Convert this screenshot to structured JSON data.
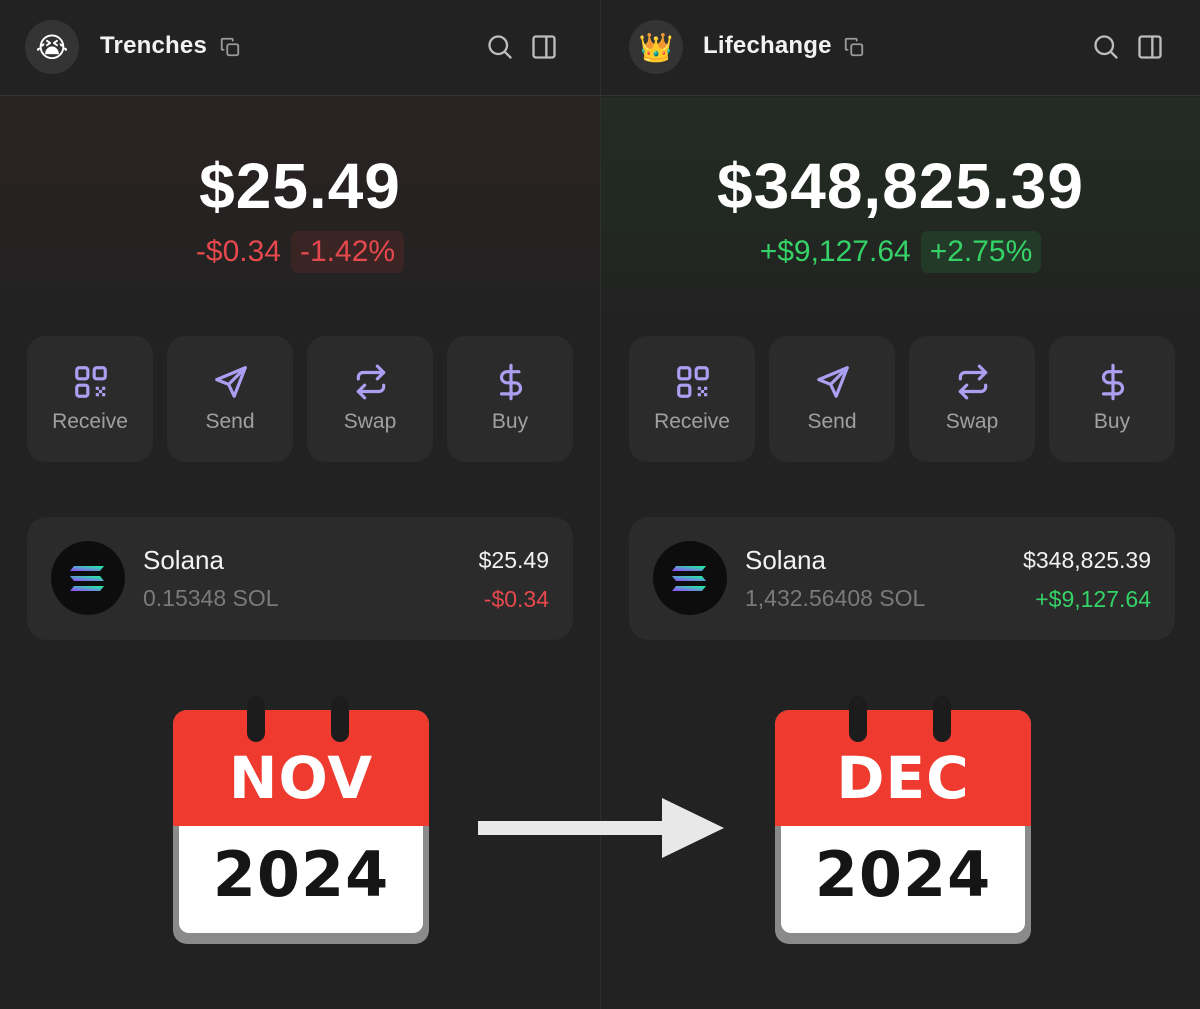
{
  "left": {
    "wallet_name": "Trenches",
    "avatar_emoji": "😭",
    "balance": "$25.49",
    "change_abs": "-$0.34",
    "change_pct": "-1.42%",
    "trend": "negative",
    "actions": [
      {
        "label": "Receive",
        "icon": "qr-code-icon"
      },
      {
        "label": "Send",
        "icon": "send-icon"
      },
      {
        "label": "Swap",
        "icon": "swap-icon"
      },
      {
        "label": "Buy",
        "icon": "dollar-icon"
      }
    ],
    "token": {
      "name": "Solana",
      "amount": "0.15348 SOL",
      "value": "$25.49",
      "change": "-$0.34"
    },
    "calendar": {
      "month": "NOV",
      "year": "2024"
    }
  },
  "right": {
    "wallet_name": "Lifechange",
    "avatar_emoji": "👑",
    "balance": "$348,825.39",
    "change_abs": "+$9,127.64",
    "change_pct": "+2.75%",
    "trend": "positive",
    "actions": [
      {
        "label": "Receive",
        "icon": "qr-code-icon"
      },
      {
        "label": "Send",
        "icon": "send-icon"
      },
      {
        "label": "Swap",
        "icon": "swap-icon"
      },
      {
        "label": "Buy",
        "icon": "dollar-icon"
      }
    ],
    "token": {
      "name": "Solana",
      "amount": "1,432.56408 SOL",
      "value": "$348,825.39",
      "change": "+$9,127.64"
    },
    "calendar": {
      "month": "DEC",
      "year": "2024"
    }
  },
  "colors": {
    "background": "#222222",
    "card": "#2b2b2b",
    "accent_purple": "#ab9ff2",
    "negative": "#e5484d",
    "positive": "#35d367",
    "calendar_red": "#ef3a2f"
  }
}
